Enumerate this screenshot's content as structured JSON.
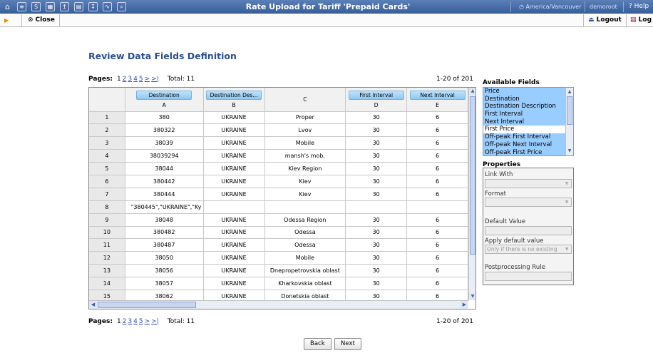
{
  "topbar": {
    "icons": [
      "home-icon",
      "list-icon",
      "s-icon",
      "grid-icon",
      "upload-icon",
      "table-icon",
      "download-icon",
      "chart-icon",
      "zoom-icon"
    ],
    "title": "Rate Upload for Tariff 'Prepaid Cards'",
    "timezone": "America/Vancouver",
    "user": "demoroot",
    "help": "Help"
  },
  "toolbar": {
    "close_label": "Close",
    "logout_label": "Logout",
    "log_label": "Log"
  },
  "heading": "Review Data Fields Definition",
  "pager": {
    "label": "Pages:",
    "current": "1",
    "pages": [
      "2",
      "3",
      "4",
      "5",
      ">",
      ">|"
    ],
    "total": "Total: 11",
    "range": "1-20 of 201"
  },
  "grid": {
    "columns": [
      {
        "field": "Destination",
        "letter": "A"
      },
      {
        "field": "Destination Des...",
        "letter": "B"
      },
      {
        "field": "",
        "letter": "C"
      },
      {
        "field": "First Interval",
        "letter": "D"
      },
      {
        "field": "Next Interval",
        "letter": "E"
      }
    ],
    "rows": [
      {
        "n": "1",
        "cells": [
          "380",
          "UKRAINE",
          "Proper",
          "30",
          "6"
        ]
      },
      {
        "n": "2",
        "cells": [
          "380322",
          "UKRAINE",
          "Lvov",
          "30",
          "6"
        ]
      },
      {
        "n": "3",
        "cells": [
          "38039",
          "UKRAINE",
          "Mobile",
          "30",
          "6"
        ]
      },
      {
        "n": "4",
        "cells": [
          "38039294",
          "UKRAINE",
          "mansh's mob.",
          "30",
          "6"
        ]
      },
      {
        "n": "5",
        "cells": [
          "38044",
          "UKRAINE",
          "Kiev Region",
          "30",
          "6"
        ]
      },
      {
        "n": "6",
        "cells": [
          "380442",
          "UKRAINE",
          "Kiev",
          "30",
          "6"
        ]
      },
      {
        "n": "7",
        "cells": [
          "380444",
          "UKRAINE",
          "Kiev",
          "30",
          "6"
        ]
      },
      {
        "n": "8",
        "cells": [
          "\"380445\",\"UKRAINE\",\"Ky",
          "",
          "",
          "",
          ""
        ]
      },
      {
        "n": "9",
        "cells": [
          "38048",
          "UKRAINE",
          "Odessa Region",
          "30",
          "6"
        ]
      },
      {
        "n": "10",
        "cells": [
          "380482",
          "UKRAINE",
          "Odessa",
          "30",
          "6"
        ]
      },
      {
        "n": "11",
        "cells": [
          "380487",
          "UKRAINE",
          "Odessa",
          "30",
          "6"
        ]
      },
      {
        "n": "12",
        "cells": [
          "38050",
          "UKRAINE",
          "Mobile",
          "30",
          "6"
        ]
      },
      {
        "n": "13",
        "cells": [
          "38056",
          "UKRAINE",
          "Dnepropetrovskia oblast",
          "30",
          "6"
        ]
      },
      {
        "n": "14",
        "cells": [
          "38057",
          "UKRAINE",
          "Kharkovskia oblast",
          "30",
          "6"
        ]
      },
      {
        "n": "15",
        "cells": [
          "38062",
          "UKRAINE",
          "Donetskia oblast",
          "30",
          "6"
        ]
      }
    ]
  },
  "available": {
    "title": "Available Fields",
    "items": [
      {
        "label": "Price",
        "selected": true
      },
      {
        "label": "Destination",
        "selected": true
      },
      {
        "label": "Destination Description",
        "selected": true
      },
      {
        "label": "First Interval",
        "selected": true
      },
      {
        "label": "Next Interval",
        "selected": true
      },
      {
        "label": "First Price",
        "selected": false
      },
      {
        "label": "Off-peak First Interval",
        "selected": true
      },
      {
        "label": "Off-peak Next Interval",
        "selected": true
      },
      {
        "label": "Off-peak First Price",
        "selected": true
      }
    ]
  },
  "properties": {
    "title": "Properties",
    "link_with": "Link With",
    "format": "Format",
    "default_value": "Default Value",
    "apply_default": "Apply default value",
    "apply_default_value": "Only if there is no existing",
    "postprocessing": "Postprocessing Rule"
  },
  "buttons": {
    "back": "Back",
    "next": "Next"
  },
  "colors": {
    "topbar": "#39609c",
    "heading": "#2b4f8f",
    "field_button": "#8dc7ef",
    "selection": "#99ccff"
  }
}
